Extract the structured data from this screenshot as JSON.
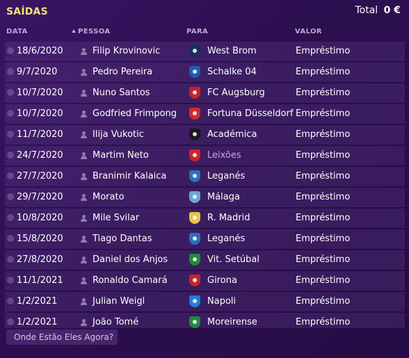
{
  "header": {
    "title": "SAÍDAS",
    "total_label": "Total",
    "total_value": "0 €"
  },
  "columns": {
    "date": "DATA",
    "person": "PESSOA",
    "to": "PARA",
    "value": "VALOR"
  },
  "rows": [
    {
      "date": "18/6/2020",
      "name": "Filip Krovinovic",
      "club": "West Brom",
      "club_color": "#1c2e5a",
      "value": "Empréstimo"
    },
    {
      "date": "9/7/2020",
      "name": "Pedro Pereira",
      "club": "Schalke 04",
      "club_color": "#1b5fb0",
      "value": "Empréstimo"
    },
    {
      "date": "10/7/2020",
      "name": "Nuno Santos",
      "club": "FC Augsburg",
      "club_color": "#c8231f",
      "value": "Empréstimo"
    },
    {
      "date": "10/7/2020",
      "name": "Godfried Frimpong",
      "club": "Fortuna Düsseldorf",
      "club_color": "#d42a2a",
      "value": "Empréstimo"
    },
    {
      "date": "11/7/2020",
      "name": "Ilija Vukotic",
      "club": "Académica",
      "club_color": "#1a1a1a",
      "value": "Empréstimo"
    },
    {
      "date": "24/7/2020",
      "name": "Martim Neto",
      "club": "Leixões",
      "club_color": "#d2232a",
      "value": "Empréstimo",
      "club_link": true
    },
    {
      "date": "27/7/2020",
      "name": "Branimir Kalaica",
      "club": "Leganés",
      "club_color": "#2a6fc0",
      "value": "Empréstimo"
    },
    {
      "date": "29/7/2020",
      "name": "Morato",
      "club": "Málaga",
      "club_color": "#6ba6d9",
      "value": "Empréstimo"
    },
    {
      "date": "10/8/2020",
      "name": "Mile Svilar",
      "club": "R. Madrid",
      "club_color": "#e6c34a",
      "value": "Empréstimo"
    },
    {
      "date": "15/8/2020",
      "name": "Tiago Dantas",
      "club": "Leganés",
      "club_color": "#2a6fc0",
      "value": "Empréstimo"
    },
    {
      "date": "27/8/2020",
      "name": "Daniel dos Anjos",
      "club": "Vit. Setúbal",
      "club_color": "#1f8a3a",
      "value": "Empréstimo"
    },
    {
      "date": "11/1/2021",
      "name": "Ronaldo Camará",
      "club": "Girona",
      "club_color": "#c8232a",
      "value": "Empréstimo"
    },
    {
      "date": "1/2/2021",
      "name": "Julian Weigl",
      "club": "Napoli",
      "club_color": "#1d7fd6",
      "value": "Empréstimo"
    },
    {
      "date": "1/2/2021",
      "name": "João Tomé",
      "club": "Moreirense",
      "club_color": "#1e8a3a",
      "value": "Empréstimo"
    }
  ],
  "footer": {
    "link": "Onde Estão Eles Agora?"
  }
}
